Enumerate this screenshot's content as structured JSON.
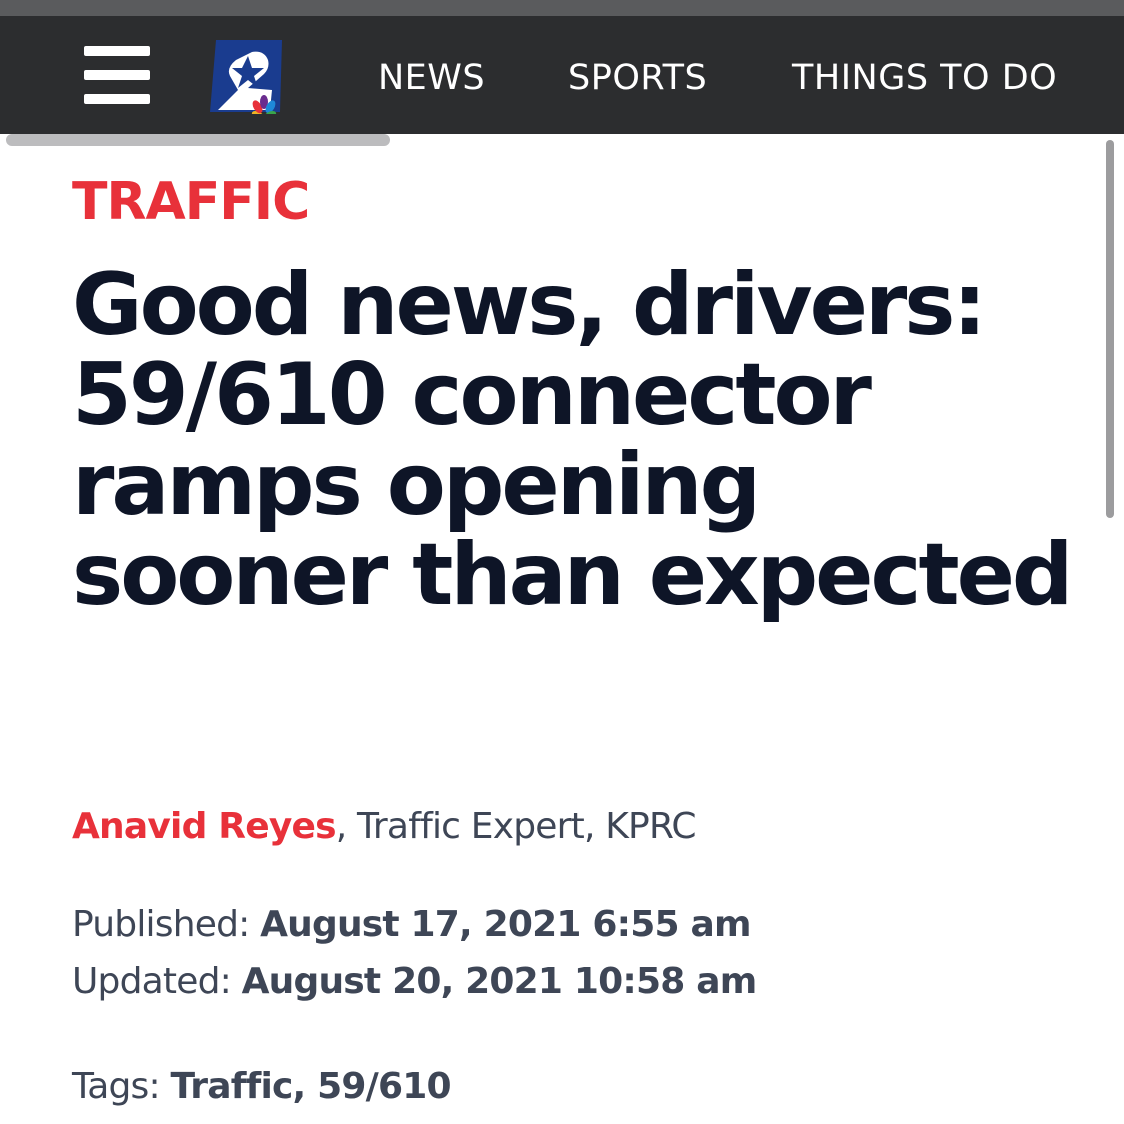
{
  "header": {
    "logo_icon": "kprc-channel-2-logo",
    "nav": {
      "news": "NEWS",
      "sports": "SPORTS",
      "things_to_do": "THINGS TO DO"
    }
  },
  "article": {
    "section": "TRAFFIC",
    "headline": "Good news, drivers: 59/610 connector ramps opening sooner than expected",
    "author": "Anavid Reyes",
    "author_role": ", Traffic Expert, KPRC",
    "published_label": "Published: ",
    "published_value": "August 17, 2021 6:55 am",
    "updated_label": "Updated: ",
    "updated_value": "August 20, 2021 10:58 am",
    "tags_label": "Tags: ",
    "tag_1": "Traffic",
    "tag_separator": ", ",
    "tag_2": "59/610"
  },
  "colors": {
    "accent": "#e8313a",
    "headline": "#0e1527",
    "navbar": "#2c2d2f",
    "meta_text": "#3e4656"
  }
}
